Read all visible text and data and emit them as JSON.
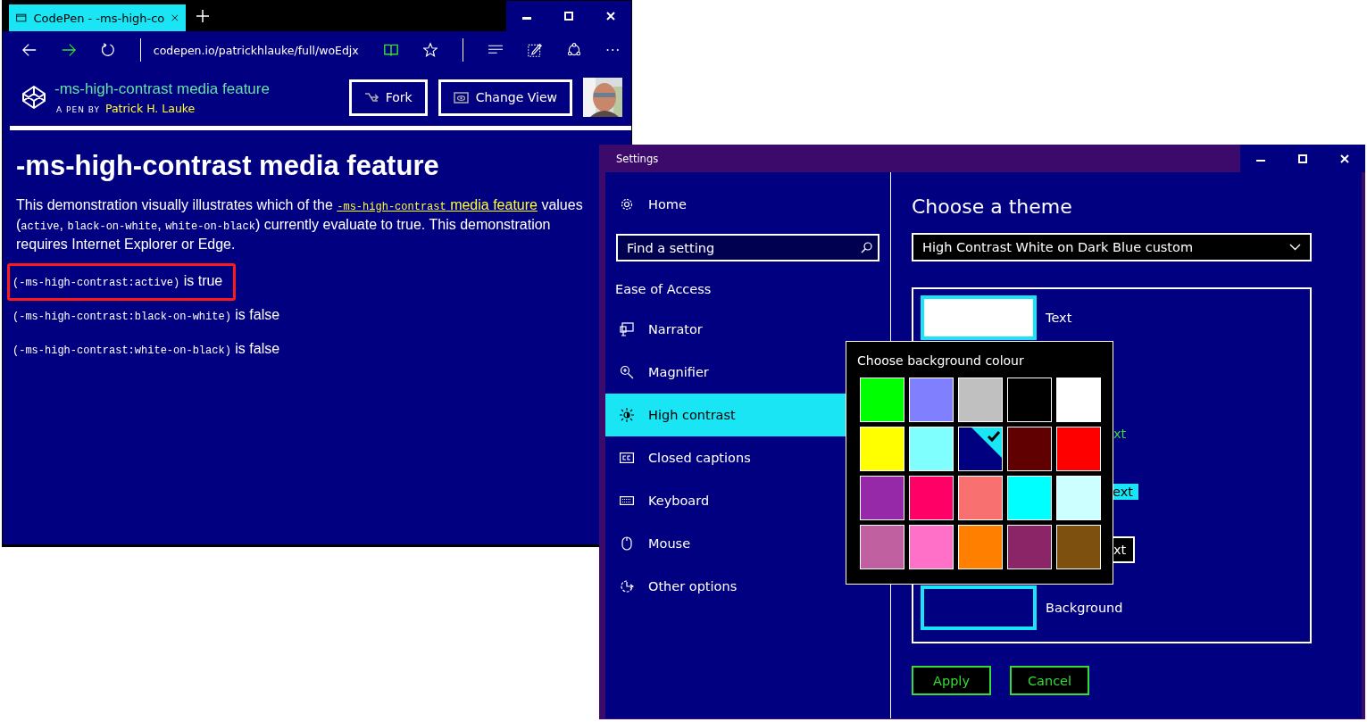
{
  "browser": {
    "tab_title": "CodePen - -ms-high-co",
    "url": "codepen.io/patrickhlauke/full/woEdjx",
    "pen_title": "-ms-high-contrast media feature",
    "byline": "A PEN BY",
    "author": "Patrick H. Lauke",
    "buttons": [
      {
        "label": "Fork",
        "kind": "fork"
      },
      {
        "label": "Change View",
        "kind": "view"
      }
    ]
  },
  "page": {
    "heading": "-ms-high-contrast media feature",
    "intro": [
      {
        "kind": "plain",
        "text": "This demonstration visually illustrates which of the "
      },
      {
        "kind": "link",
        "parts": [
          {
            "kind": "code",
            "text": "-ms-high-contrast"
          },
          {
            "kind": "plain",
            "text": " media feature"
          }
        ]
      },
      {
        "kind": "plain",
        "text": " values ("
      },
      {
        "kind": "code",
        "text": "active"
      },
      {
        "kind": "plain",
        "text": ", "
      },
      {
        "kind": "code",
        "text": "black-on-white"
      },
      {
        "kind": "plain",
        "text": ", "
      },
      {
        "kind": "code",
        "text": "white-on-black"
      },
      {
        "kind": "plain",
        "text": ") currently evaluate to true. This demonstration requires Internet Explorer or Edge."
      }
    ],
    "results": [
      {
        "query": "(-ms-high-contrast:active)",
        "result": "is true",
        "highlighted": true
      },
      {
        "query": "(-ms-high-contrast:black-on-white)",
        "result": "is false",
        "highlighted": false
      },
      {
        "query": "(-ms-high-contrast:white-on-black)",
        "result": "is false",
        "highlighted": false
      }
    ]
  },
  "settings": {
    "title": "Settings",
    "home": "Home",
    "search": {
      "placeholder": "Find a setting"
    },
    "section": "Ease of Access",
    "nav": [
      {
        "label": "Narrator",
        "kind": "narrator",
        "selected": false
      },
      {
        "label": "Magnifier",
        "kind": "magnifier",
        "selected": false
      },
      {
        "label": "High contrast",
        "kind": "contrast",
        "selected": true
      },
      {
        "label": "Closed captions",
        "kind": "captions",
        "selected": false
      },
      {
        "label": "Keyboard",
        "kind": "keyboard",
        "selected": false
      },
      {
        "label": "Mouse",
        "kind": "mouse",
        "selected": false
      },
      {
        "label": "Other options",
        "kind": "other",
        "selected": false
      }
    ],
    "heading": "Choose a theme",
    "theme": "High Contrast White on Dark Blue custom",
    "rows": [
      {
        "kind": "swatch",
        "color": "#ffffff",
        "label": "Text"
      },
      {
        "kind": "hyperlink",
        "label": "xt"
      },
      {
        "kind": "selected-text",
        "label": "ext"
      },
      {
        "kind": "button-text",
        "label": "xt"
      },
      {
        "kind": "swatch",
        "color": "#000080",
        "label": "Background"
      }
    ],
    "popup": {
      "title": "Choose background colour",
      "swatches": [
        {
          "color": "#00ff00",
          "selected": false
        },
        {
          "color": "#8080ff",
          "selected": false
        },
        {
          "color": "#c0c0c0",
          "selected": false
        },
        {
          "color": "#000000",
          "selected": false
        },
        {
          "color": "#ffffff",
          "selected": false
        },
        {
          "color": "#ffff00",
          "selected": false
        },
        {
          "color": "#80ffff",
          "selected": false
        },
        {
          "color": "#000080",
          "selected": true
        },
        {
          "color": "#600000",
          "selected": false
        },
        {
          "color": "#ff0000",
          "selected": false
        },
        {
          "color": "#9629a8",
          "selected": false
        },
        {
          "color": "#ff0066",
          "selected": false
        },
        {
          "color": "#f87070",
          "selected": false
        },
        {
          "color": "#00ffff",
          "selected": false
        },
        {
          "color": "#ccffff",
          "selected": false
        },
        {
          "color": "#c060a0",
          "selected": false
        },
        {
          "color": "#ff70c8",
          "selected": false
        },
        {
          "color": "#ff8000",
          "selected": false
        },
        {
          "color": "#8c2468",
          "selected": false
        },
        {
          "color": "#7e5010",
          "selected": false
        }
      ]
    },
    "buttons": [
      "Apply",
      "Cancel"
    ]
  }
}
